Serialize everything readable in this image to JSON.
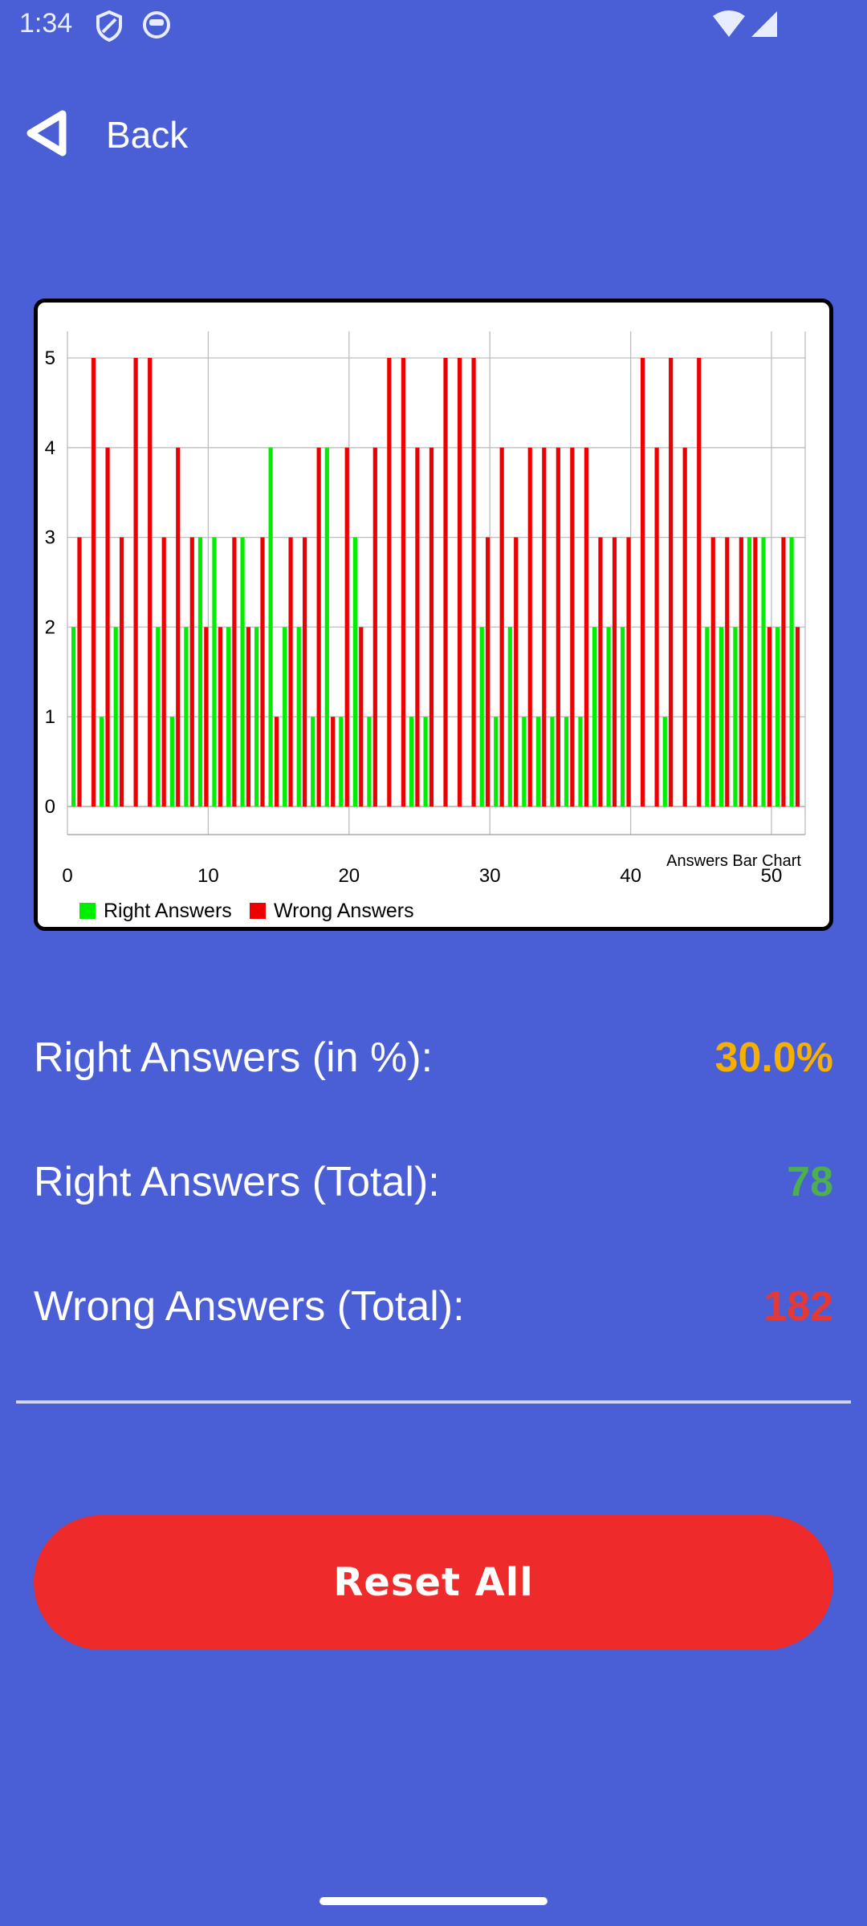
{
  "status_bar": {
    "time": "1:34",
    "icons": [
      "shield-icon",
      "robot-face-icon",
      "wifi-icon",
      "cellular-signal-icon"
    ]
  },
  "nav": {
    "back_label": "Back",
    "back_icon": "back-triangle-icon"
  },
  "chart_data": {
    "type": "bar",
    "description_label": "Answers Bar Chart",
    "x_ticks": [
      "0",
      "10",
      "20",
      "30",
      "40",
      "50"
    ],
    "y_ticks": [
      "0",
      "1",
      "2",
      "3",
      "4",
      "5"
    ],
    "xlim": [
      0,
      52
    ],
    "ylim": [
      0,
      5
    ],
    "grid": true,
    "legend_position": "bottom-left",
    "x": [
      1,
      2,
      3,
      4,
      5,
      6,
      7,
      8,
      9,
      10,
      11,
      12,
      13,
      14,
      15,
      16,
      17,
      18,
      19,
      20,
      21,
      22,
      23,
      24,
      25,
      26,
      27,
      28,
      29,
      30,
      31,
      32,
      33,
      34,
      35,
      36,
      37,
      38,
      39,
      40,
      41,
      42,
      43,
      44,
      45,
      46,
      47,
      48,
      49,
      50,
      51,
      52
    ],
    "series": [
      {
        "name": "Right Answers",
        "color": "#00ee00",
        "values": [
          2,
          0,
          1,
          2,
          0,
          0,
          2,
          1,
          2,
          3,
          3,
          2,
          3,
          2,
          4,
          2,
          2,
          1,
          4,
          1,
          3,
          1,
          0,
          0,
          1,
          1,
          0,
          0,
          0,
          2,
          1,
          2,
          1,
          1,
          1,
          1,
          1,
          2,
          2,
          2,
          0,
          0,
          1,
          0,
          0,
          2,
          2,
          2,
          3,
          3,
          2,
          3
        ]
      },
      {
        "name": "Wrong Answers",
        "color": "#ee0000",
        "values": [
          3,
          5,
          4,
          3,
          5,
          5,
          3,
          4,
          3,
          2,
          2,
          3,
          2,
          3,
          1,
          3,
          3,
          4,
          1,
          4,
          2,
          4,
          5,
          5,
          4,
          4,
          5,
          5,
          5,
          3,
          4,
          3,
          4,
          4,
          4,
          4,
          4,
          3,
          3,
          3,
          5,
          4,
          5,
          4,
          5,
          3,
          3,
          3,
          3,
          2,
          3,
          2
        ]
      }
    ]
  },
  "stats": {
    "percent_label": "Right Answers (in %):",
    "percent_value": "30.0%",
    "percent_color": "#f5b000",
    "right_label": "Right Answers (Total):",
    "right_value": "78",
    "right_color": "#4caf50",
    "wrong_label": "Wrong Answers (Total):",
    "wrong_value": "182",
    "wrong_color": "#e53935"
  },
  "reset_button": {
    "label": "Reset All",
    "color": "#ee2a2a"
  }
}
